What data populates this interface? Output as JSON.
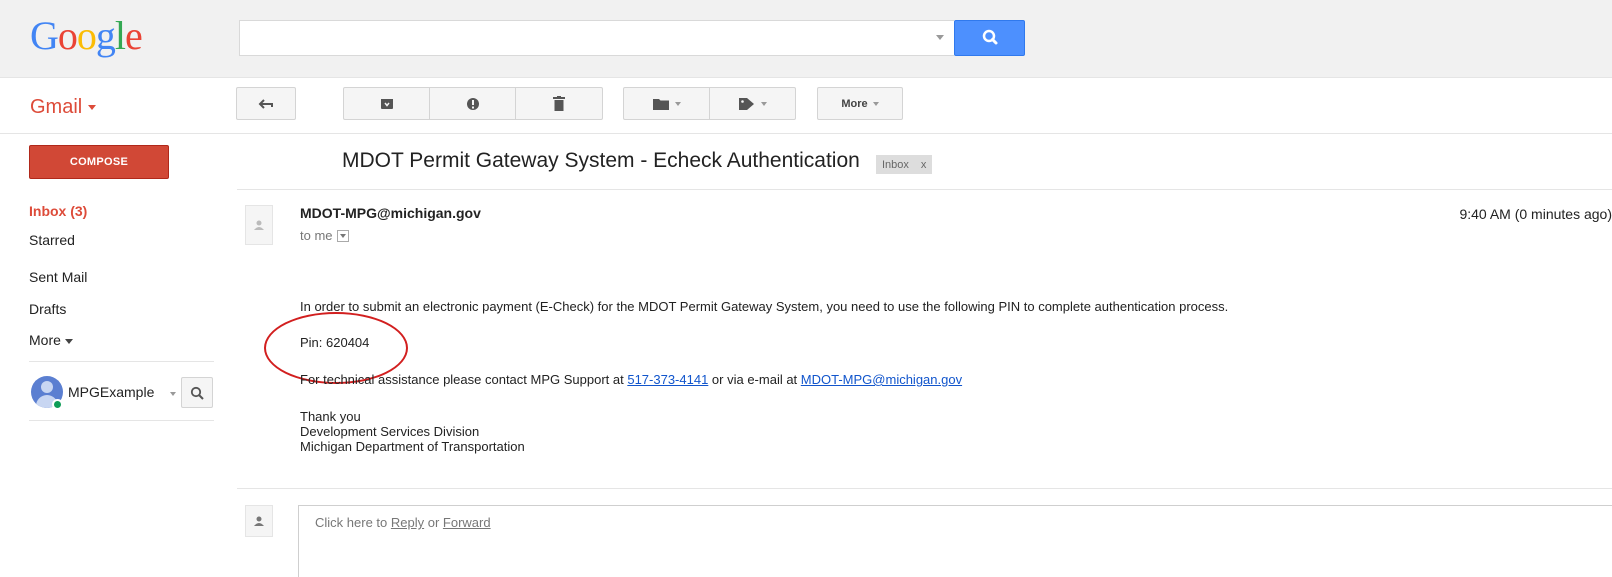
{
  "app": {
    "logo_letters": [
      {
        "ch": "G",
        "color": "#4285f4"
      },
      {
        "ch": "o",
        "color": "#ea4335"
      },
      {
        "ch": "o",
        "color": "#fbbc05"
      },
      {
        "ch": "g",
        "color": "#4285f4"
      },
      {
        "ch": "l",
        "color": "#34a853"
      },
      {
        "ch": "e",
        "color": "#ea4335"
      }
    ],
    "product_label": "Gmail",
    "accent_red": "#dd4b39",
    "search_blue": "#4d90fe"
  },
  "search": {
    "placeholder": "",
    "value": ""
  },
  "toolbar": {
    "reply_icon": "reply-icon",
    "archive_icon": "archive-icon",
    "spam_icon": "report-spam-icon",
    "delete_icon": "trash-icon",
    "folder_icon": "folder-icon",
    "label_icon": "tag-icon",
    "more_label": "More"
  },
  "sidebar": {
    "compose_label": "COMPOSE",
    "items": [
      {
        "label": "Inbox (3)",
        "active": true
      },
      {
        "label": "Starred",
        "active": false
      },
      {
        "label": "Sent Mail",
        "active": false
      },
      {
        "label": "Drafts",
        "active": false
      },
      {
        "label": "More",
        "active": false
      }
    ],
    "user_name": "MPGExample"
  },
  "message": {
    "subject": "MDOT Permit Gateway System - Echeck Authentication",
    "label_chip": "Inbox",
    "label_chip_close": "x",
    "sender": "MDOT-MPG@michigan.gov",
    "recipient": "to me",
    "time": "9:40 AM (0 minutes ago)",
    "body_intro": "In order to submit an electronic payment (E-Check) for the MDOT Permit Gateway System, you need to use the following PIN to complete authentication process.",
    "pin_line": "Pin: 620404",
    "support_prefix": "For technical assistance please contact MPG Support at ",
    "support_phone": "517-373-4141",
    "support_mid": " or via e-mail at ",
    "support_email": "MDOT-MPG@michigan.gov",
    "sign_1": "Thank you",
    "sign_2": "Development Services Division",
    "sign_3": "Michigan Department of Transportation"
  },
  "reply": {
    "prefix": "Click here to ",
    "reply_link": "Reply",
    "mid": " or ",
    "forward_link": "Forward"
  }
}
